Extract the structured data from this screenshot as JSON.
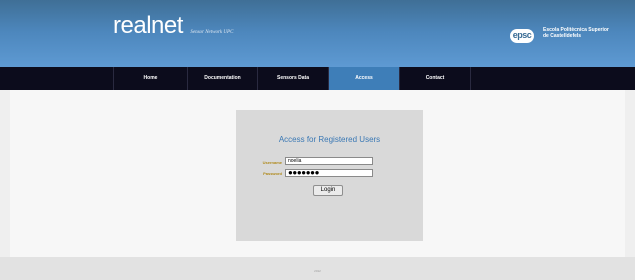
{
  "header": {
    "brand_name": "realnet",
    "brand_tagline": "Sensor Network UPC",
    "school_logo": "epsc",
    "school_name_line1": "Escola Politècnica Superior",
    "school_name_line2": "de Castelldefels"
  },
  "nav": {
    "items": [
      {
        "label": "Home"
      },
      {
        "label": "Documentation"
      },
      {
        "label": "Sensors Data"
      },
      {
        "label": "Access"
      },
      {
        "label": "Contact"
      }
    ],
    "active": "Access"
  },
  "login": {
    "title": "Access for Registered Users",
    "username_label": "Username",
    "username_value": "noelia",
    "password_label": "Password",
    "password_value": "●●●●●●●",
    "button_label": "Login"
  },
  "footer": {
    "text": "2012"
  },
  "colors": {
    "header_blue": "#4d87bd",
    "nav_dark": "#0c0c1c",
    "nav_active": "#3e7eb8",
    "title_blue": "#3a78b4",
    "label_gold": "#b08a1c"
  }
}
